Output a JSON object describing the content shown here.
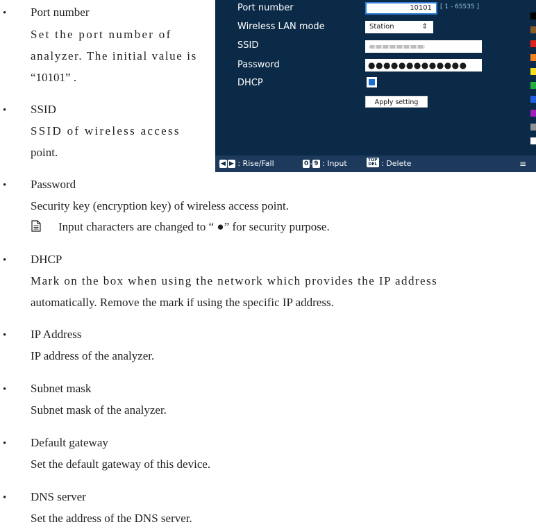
{
  "items": [
    {
      "bullet": "•",
      "title": "Port number",
      "desc": [
        "Set the port number of",
        "analyzer. The initial value is",
        "“10101” ."
      ]
    },
    {
      "bullet": "•",
      "title": "SSID",
      "desc": [
        "SSID of wireless access",
        "point."
      ]
    },
    {
      "bullet": "•",
      "title": "Password",
      "desc": [
        "Security key (encryption key) of wireless access point."
      ],
      "note": "Input characters are changed to “ ●” for security purpose."
    },
    {
      "bullet": "•",
      "title": "DHCP",
      "desc": [
        "Mark on the box when using the network which provides the IP address",
        "automatically. Remove the mark if using the specific IP address."
      ]
    },
    {
      "bullet": "•",
      "title": "IP Address",
      "desc": [
        "IP address of the analyzer."
      ]
    },
    {
      "bullet": "•",
      "title": "Subnet mask",
      "desc": [
        "Subnet mask of the analyzer."
      ]
    },
    {
      "bullet": "•",
      "title": "Default gateway",
      "desc": [
        "Set the default gateway of this device."
      ]
    },
    {
      "bullet": "•",
      "title": "DNS server",
      "desc": [
        "Set the address of the DNS server."
      ]
    }
  ],
  "screen": {
    "labels": {
      "port": "Port number",
      "mode": "Wireless LAN mode",
      "ssid": "SSID",
      "password": "Password",
      "dhcp": "DHCP"
    },
    "port_value": "10101",
    "port_range": "[ 1 - 65535 ]",
    "mode_value": "Station",
    "mode_caret": "⇕",
    "password_value": "●●●●●●●●●●●●●",
    "dhcp_checked": true,
    "apply_label": "Apply setting",
    "status": {
      "rise_fall": ": Rise/Fall",
      "key0": "0",
      "key9": "9",
      "input": ": Input",
      "delkey_top": "TOP",
      "delkey_bottom": "DEL",
      "delete": ": Delete",
      "menu_icon": "menu-icon"
    },
    "strip_colors": [
      "#000000",
      "#8a5a2b",
      "#e02020",
      "#f08020",
      "#f0e020",
      "#20b040",
      "#2060e0",
      "#a020c0",
      "#909090",
      "#ffffff"
    ]
  },
  "colors": {
    "screen_bg": "#0b2a47",
    "accent_blue": "#2f7fd8"
  }
}
